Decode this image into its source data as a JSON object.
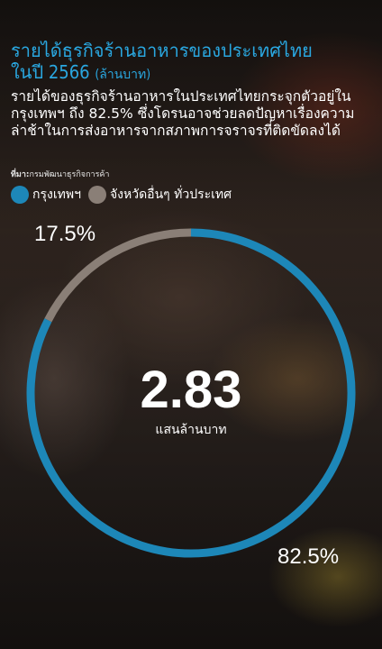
{
  "title": "รายได้ธุรกิจร้านอาหารของประเทศไทย",
  "title_line2": "ในปี 2566",
  "title_unit": "(ล้านบาท)",
  "subtitle": "รายได้ของธุรกิจร้านอาหารในประเทศไทยกระจุกตัวอยู่ในกรุงเทพฯ ถึง 82.5% ซึ่งโดรนอาจช่วยลดปัญหาเรื่องความล่าช้าในการส่งอาหารจากสภาพการจราจรที่ติดขัดลงได้",
  "source_label": "ที่มา:",
  "source": "กรมพัฒนาธุรกิจการค้า",
  "center_value": "2.83",
  "center_unit": "แสนล้านบาท",
  "colors": {
    "bangkok": "#1d87b8",
    "other": "#8a7f77",
    "accent": "#2aa7e0"
  },
  "chart_data": {
    "type": "pie",
    "variant": "donut",
    "title": "รายได้ธุรกิจร้านอาหารของประเทศไทยในปี 2566",
    "unit": "ล้านบาท",
    "total_label": "2.83 แสนล้านบาท",
    "categories": [
      "กรุงเทพฯ",
      "จังหวัดอื่นๆ ทั่วประเทศ"
    ],
    "values": [
      82.5,
      17.5
    ],
    "labels": [
      "82.5%",
      "17.5%"
    ],
    "colors": [
      "#1d87b8",
      "#8a7f77"
    ],
    "legend": "top-left"
  }
}
